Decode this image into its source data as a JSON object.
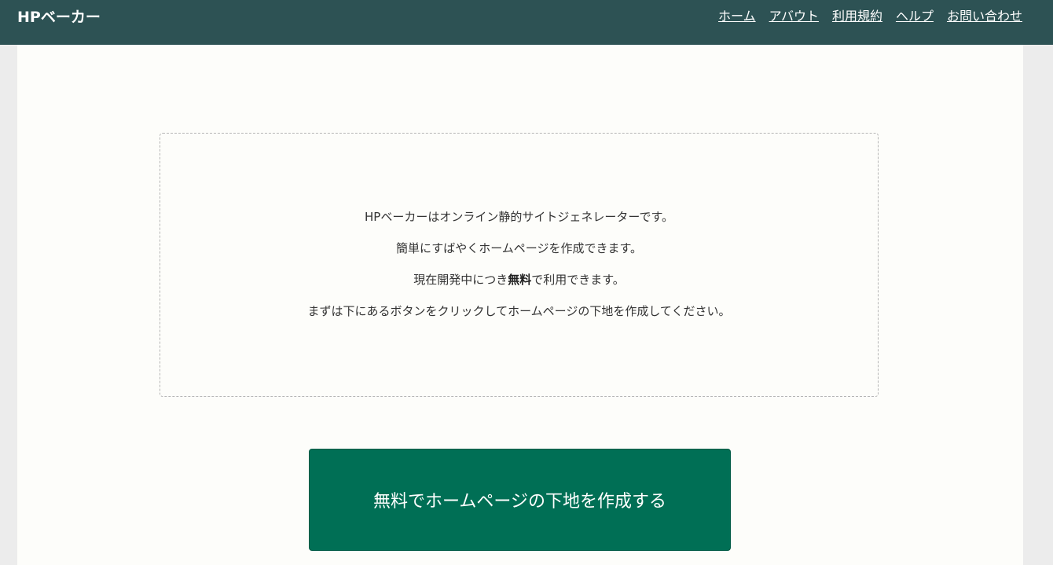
{
  "header": {
    "brand": "HPベーカー",
    "nav": [
      "ホーム",
      "アバウト",
      "利用規約",
      "ヘルプ",
      "お問い合わせ"
    ],
    "background_color": "#2d5254"
  },
  "intro": {
    "line1": "HPベーカーはオンライン静的サイトジェネレーターです。",
    "line2": "簡単にすばやくホームページを作成できます。",
    "line3_prefix": "現在開発中につき",
    "line3_bold": "無料",
    "line3_suffix": "で利用できます。",
    "line4": "まずは下にあるボタンをクリックしてホームページの下地を作成してください。"
  },
  "cta": {
    "label": "無料でホームページの下地を作成する",
    "color": "#006f55"
  }
}
